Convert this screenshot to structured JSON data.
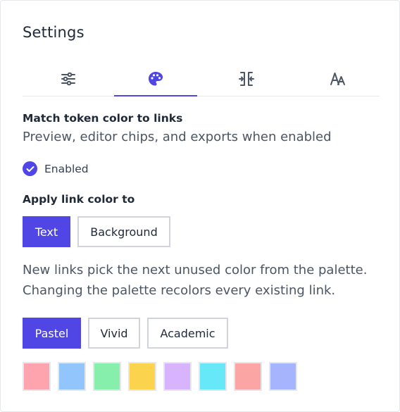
{
  "header": {
    "title": "Settings"
  },
  "tabs": [
    {
      "name": "tab-sliders",
      "icon": "sliders-icon",
      "active": false
    },
    {
      "name": "tab-palette",
      "icon": "palette-icon",
      "active": true
    },
    {
      "name": "tab-spacing",
      "icon": "columns-spacing-icon",
      "active": false
    },
    {
      "name": "tab-typography",
      "icon": "font-size-icon",
      "active": false
    }
  ],
  "match_token": {
    "heading": "Match token color to links",
    "description": "Preview, editor chips, and exports when enabled",
    "checkbox_label": "Enabled",
    "checked": true
  },
  "apply_link": {
    "heading": "Apply link color to",
    "options": [
      "Text",
      "Background"
    ],
    "selected": "Text"
  },
  "palette_info": {
    "line1": "New links pick the next unused color from the palette.",
    "line2": "Changing the palette recolors every existing link."
  },
  "palette": {
    "options": [
      "Pastel",
      "Vivid",
      "Academic"
    ],
    "selected": "Pastel",
    "swatches": [
      "#fda4af",
      "#93c5fd",
      "#86efac",
      "#fcd34d",
      "#d8b4fe",
      "#67e8f9",
      "#fca5a5",
      "#a5b4fc"
    ]
  },
  "colors": {
    "accent": "#4f46e5",
    "border": "#d1d5db",
    "icon": "#4b5563"
  }
}
